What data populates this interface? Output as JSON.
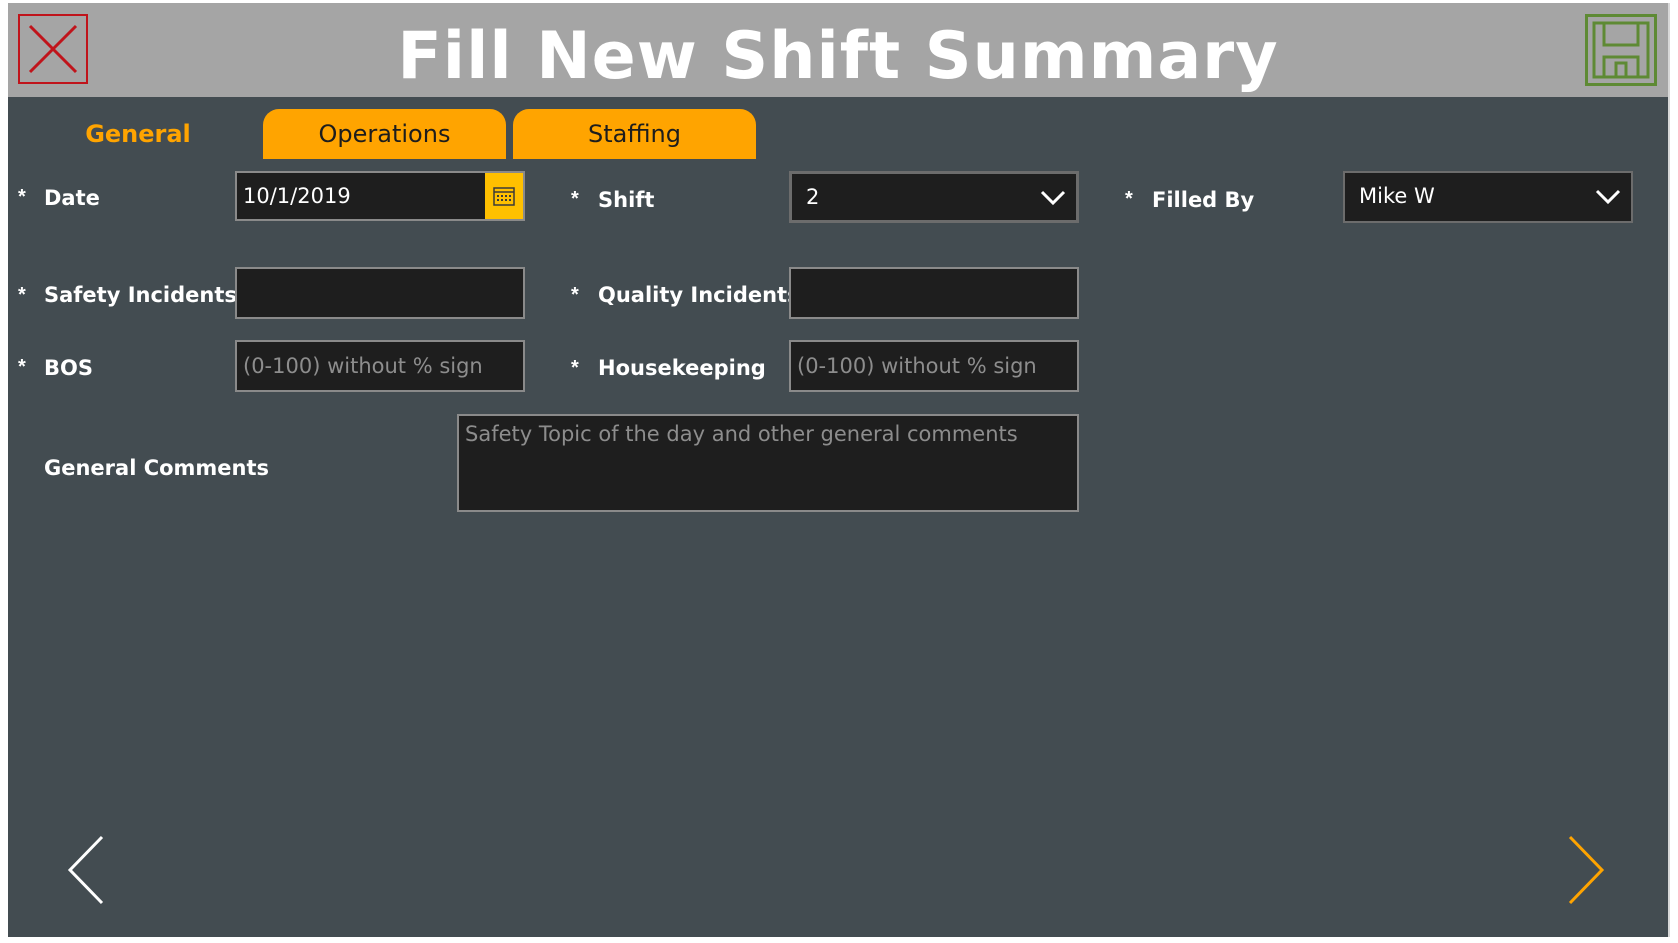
{
  "header": {
    "title": "Fill New Shift Summary"
  },
  "tabs": [
    {
      "label": "General",
      "active": true
    },
    {
      "label": "Operations",
      "active": false
    },
    {
      "label": "Staffing",
      "active": false
    }
  ],
  "form": {
    "required_marker": "*",
    "date": {
      "label": "Date",
      "value": "10/1/2019"
    },
    "shift": {
      "label": "Shift",
      "value": "2"
    },
    "filled_by": {
      "label": "Filled By",
      "value": "Mike W"
    },
    "safety_incidents": {
      "label": "Safety Incidents",
      "value": ""
    },
    "quality_incidents": {
      "label": "Quality Incidents",
      "value": ""
    },
    "bos": {
      "label": "BOS",
      "placeholder": "(0-100) without % sign"
    },
    "housekeeping": {
      "label": "Housekeeping",
      "placeholder": "(0-100) without % sign"
    },
    "general_comments": {
      "label": "General Comments",
      "placeholder": "Safety Topic of the day and other general comments"
    }
  },
  "icons": {
    "close": "close-icon",
    "save": "save-icon",
    "calendar": "calendar-icon",
    "chevron_down": "chevron-down-icon",
    "previous": "chevron-left-icon",
    "next": "chevron-right-icon"
  },
  "colors": {
    "header_bg": "#a5a5a5",
    "body_bg": "#434c51",
    "accent": "#ffa400",
    "close": "#c0141b",
    "save": "#5e8a34",
    "calendar": "#ffc000"
  }
}
